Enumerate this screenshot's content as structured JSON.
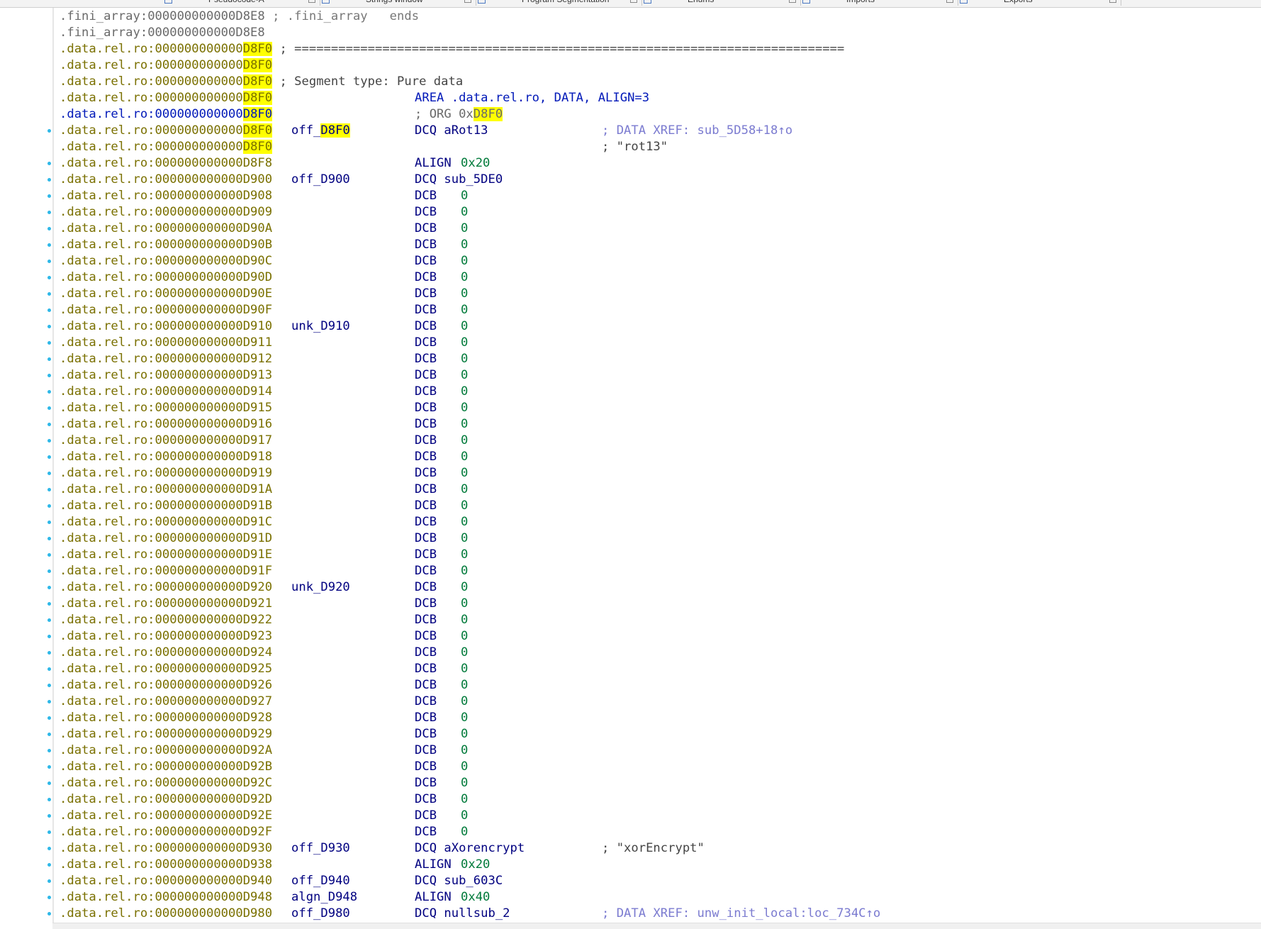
{
  "tabs": [
    {
      "label": "Pseudocode-A"
    },
    {
      "label": "Strings window"
    },
    {
      "label": "Program Segmentation"
    },
    {
      "label": "Enums"
    },
    {
      "label": "Imports"
    },
    {
      "label": "Exports"
    }
  ],
  "colors": {
    "highlight": "#ffff00",
    "segment_text": "#7a7000",
    "name_text": "#000080",
    "number_text": "#007a3a",
    "xref_text": "#7b7bd0",
    "gutter_dot": "#2fb8e8"
  },
  "lines": [
    {
      "dot": false,
      "seg": ".fini_array:",
      "addr": "000000000000D8E8",
      "addr_style": "gray",
      "tail": " ; .fini_array   ends",
      "tail_style": "cmt"
    },
    {
      "dot": false,
      "seg": ".fini_array:",
      "addr": "000000000000D8E8",
      "addr_style": "gray"
    },
    {
      "dot": false,
      "seg": ".data.rel.ro:",
      "addr_pre": "000000000000",
      "addr_hl": "D8F0",
      "tail": " ; ===========================================================================",
      "tail_style": "cmt"
    },
    {
      "dot": false,
      "seg": ".data.rel.ro:",
      "addr_pre": "000000000000",
      "addr_hl": "D8F0"
    },
    {
      "dot": false,
      "seg": ".data.rel.ro:",
      "addr_pre": "000000000000",
      "addr_hl": "D8F0",
      "tail": " ; Segment type: Pure data",
      "tail_style": "cmt"
    },
    {
      "dot": false,
      "seg": ".data.rel.ro:",
      "addr_pre": "000000000000",
      "addr_hl": "D8F0",
      "ins": "AREA .data.rel.ro, DATA, ALIGN=3",
      "ins_style": "blue"
    },
    {
      "dot": false,
      "seg": ".data.rel.ro:",
      "addr_pre": "000000000000",
      "addr_hl": "D8F0",
      "seg_style": "blue",
      "ins": "; ORG 0x",
      "ins_style": "gray",
      "ins_hl": "D8F0"
    },
    {
      "dot": true,
      "seg": ".data.rel.ro:",
      "addr_pre": "000000000000",
      "addr_hl": "D8F0",
      "name_pre": "off_",
      "name_hl": "D8F0",
      "ins": "DCQ aRot13",
      "cmt": "; DATA XREF: sub_5D58+18↑o",
      "cmt_style": "xref"
    },
    {
      "dot": false,
      "seg": ".data.rel.ro:",
      "addr_pre": "000000000000",
      "addr_hl": "D8F0",
      "cmt": "; \"rot13\"",
      "cmt_style": "cmt"
    },
    {
      "dot": true,
      "seg": ".data.rel.ro:",
      "addr": "000000000000D8F8",
      "ins": "ALIGN",
      "op": "0x20"
    },
    {
      "dot": true,
      "seg": ".data.rel.ro:",
      "addr": "000000000000D900",
      "name": "off_D900",
      "ins": "DCQ sub_5DE0"
    },
    {
      "dot": true,
      "seg": ".data.rel.ro:",
      "addr": "000000000000D908",
      "ins": "DCB",
      "op": "0"
    },
    {
      "dot": true,
      "seg": ".data.rel.ro:",
      "addr": "000000000000D909",
      "ins": "DCB",
      "op": "0"
    },
    {
      "dot": true,
      "seg": ".data.rel.ro:",
      "addr": "000000000000D90A",
      "ins": "DCB",
      "op": "0"
    },
    {
      "dot": true,
      "seg": ".data.rel.ro:",
      "addr": "000000000000D90B",
      "ins": "DCB",
      "op": "0"
    },
    {
      "dot": true,
      "seg": ".data.rel.ro:",
      "addr": "000000000000D90C",
      "ins": "DCB",
      "op": "0"
    },
    {
      "dot": true,
      "seg": ".data.rel.ro:",
      "addr": "000000000000D90D",
      "ins": "DCB",
      "op": "0"
    },
    {
      "dot": true,
      "seg": ".data.rel.ro:",
      "addr": "000000000000D90E",
      "ins": "DCB",
      "op": "0"
    },
    {
      "dot": true,
      "seg": ".data.rel.ro:",
      "addr": "000000000000D90F",
      "ins": "DCB",
      "op": "0"
    },
    {
      "dot": true,
      "seg": ".data.rel.ro:",
      "addr": "000000000000D910",
      "name": "unk_D910",
      "ins": "DCB",
      "op": "0"
    },
    {
      "dot": true,
      "seg": ".data.rel.ro:",
      "addr": "000000000000D911",
      "ins": "DCB",
      "op": "0"
    },
    {
      "dot": true,
      "seg": ".data.rel.ro:",
      "addr": "000000000000D912",
      "ins": "DCB",
      "op": "0"
    },
    {
      "dot": true,
      "seg": ".data.rel.ro:",
      "addr": "000000000000D913",
      "ins": "DCB",
      "op": "0"
    },
    {
      "dot": true,
      "seg": ".data.rel.ro:",
      "addr": "000000000000D914",
      "ins": "DCB",
      "op": "0"
    },
    {
      "dot": true,
      "seg": ".data.rel.ro:",
      "addr": "000000000000D915",
      "ins": "DCB",
      "op": "0"
    },
    {
      "dot": true,
      "seg": ".data.rel.ro:",
      "addr": "000000000000D916",
      "ins": "DCB",
      "op": "0"
    },
    {
      "dot": true,
      "seg": ".data.rel.ro:",
      "addr": "000000000000D917",
      "ins": "DCB",
      "op": "0"
    },
    {
      "dot": true,
      "seg": ".data.rel.ro:",
      "addr": "000000000000D918",
      "ins": "DCB",
      "op": "0"
    },
    {
      "dot": true,
      "seg": ".data.rel.ro:",
      "addr": "000000000000D919",
      "ins": "DCB",
      "op": "0"
    },
    {
      "dot": true,
      "seg": ".data.rel.ro:",
      "addr": "000000000000D91A",
      "ins": "DCB",
      "op": "0"
    },
    {
      "dot": true,
      "seg": ".data.rel.ro:",
      "addr": "000000000000D91B",
      "ins": "DCB",
      "op": "0"
    },
    {
      "dot": true,
      "seg": ".data.rel.ro:",
      "addr": "000000000000D91C",
      "ins": "DCB",
      "op": "0"
    },
    {
      "dot": true,
      "seg": ".data.rel.ro:",
      "addr": "000000000000D91D",
      "ins": "DCB",
      "op": "0"
    },
    {
      "dot": true,
      "seg": ".data.rel.ro:",
      "addr": "000000000000D91E",
      "ins": "DCB",
      "op": "0"
    },
    {
      "dot": true,
      "seg": ".data.rel.ro:",
      "addr": "000000000000D91F",
      "ins": "DCB",
      "op": "0"
    },
    {
      "dot": true,
      "seg": ".data.rel.ro:",
      "addr": "000000000000D920",
      "name": "unk_D920",
      "ins": "DCB",
      "op": "0"
    },
    {
      "dot": true,
      "seg": ".data.rel.ro:",
      "addr": "000000000000D921",
      "ins": "DCB",
      "op": "0"
    },
    {
      "dot": true,
      "seg": ".data.rel.ro:",
      "addr": "000000000000D922",
      "ins": "DCB",
      "op": "0"
    },
    {
      "dot": true,
      "seg": ".data.rel.ro:",
      "addr": "000000000000D923",
      "ins": "DCB",
      "op": "0"
    },
    {
      "dot": true,
      "seg": ".data.rel.ro:",
      "addr": "000000000000D924",
      "ins": "DCB",
      "op": "0"
    },
    {
      "dot": true,
      "seg": ".data.rel.ro:",
      "addr": "000000000000D925",
      "ins": "DCB",
      "op": "0"
    },
    {
      "dot": true,
      "seg": ".data.rel.ro:",
      "addr": "000000000000D926",
      "ins": "DCB",
      "op": "0"
    },
    {
      "dot": true,
      "seg": ".data.rel.ro:",
      "addr": "000000000000D927",
      "ins": "DCB",
      "op": "0"
    },
    {
      "dot": true,
      "seg": ".data.rel.ro:",
      "addr": "000000000000D928",
      "ins": "DCB",
      "op": "0"
    },
    {
      "dot": true,
      "seg": ".data.rel.ro:",
      "addr": "000000000000D929",
      "ins": "DCB",
      "op": "0"
    },
    {
      "dot": true,
      "seg": ".data.rel.ro:",
      "addr": "000000000000D92A",
      "ins": "DCB",
      "op": "0"
    },
    {
      "dot": true,
      "seg": ".data.rel.ro:",
      "addr": "000000000000D92B",
      "ins": "DCB",
      "op": "0"
    },
    {
      "dot": true,
      "seg": ".data.rel.ro:",
      "addr": "000000000000D92C",
      "ins": "DCB",
      "op": "0"
    },
    {
      "dot": true,
      "seg": ".data.rel.ro:",
      "addr": "000000000000D92D",
      "ins": "DCB",
      "op": "0"
    },
    {
      "dot": true,
      "seg": ".data.rel.ro:",
      "addr": "000000000000D92E",
      "ins": "DCB",
      "op": "0"
    },
    {
      "dot": true,
      "seg": ".data.rel.ro:",
      "addr": "000000000000D92F",
      "ins": "DCB",
      "op": "0"
    },
    {
      "dot": true,
      "seg": ".data.rel.ro:",
      "addr": "000000000000D930",
      "name": "off_D930",
      "ins": "DCQ aXorencrypt",
      "cmt": "; \"xorEncrypt\"",
      "cmt_style": "cmt"
    },
    {
      "dot": true,
      "seg": ".data.rel.ro:",
      "addr": "000000000000D938",
      "ins": "ALIGN",
      "op": "0x20"
    },
    {
      "dot": true,
      "seg": ".data.rel.ro:",
      "addr": "000000000000D940",
      "name": "off_D940",
      "ins": "DCQ sub_603C"
    },
    {
      "dot": true,
      "seg": ".data.rel.ro:",
      "addr": "000000000000D948",
      "name": "algn_D948",
      "ins": "ALIGN",
      "op": "0x40"
    },
    {
      "dot": true,
      "seg": ".data.rel.ro:",
      "addr": "000000000000D980",
      "name": "off_D980",
      "ins": "DCQ nullsub_2",
      "cmt": "; DATA XREF: unw_init_local:loc_734C↑o",
      "cmt_style": "xref"
    }
  ]
}
